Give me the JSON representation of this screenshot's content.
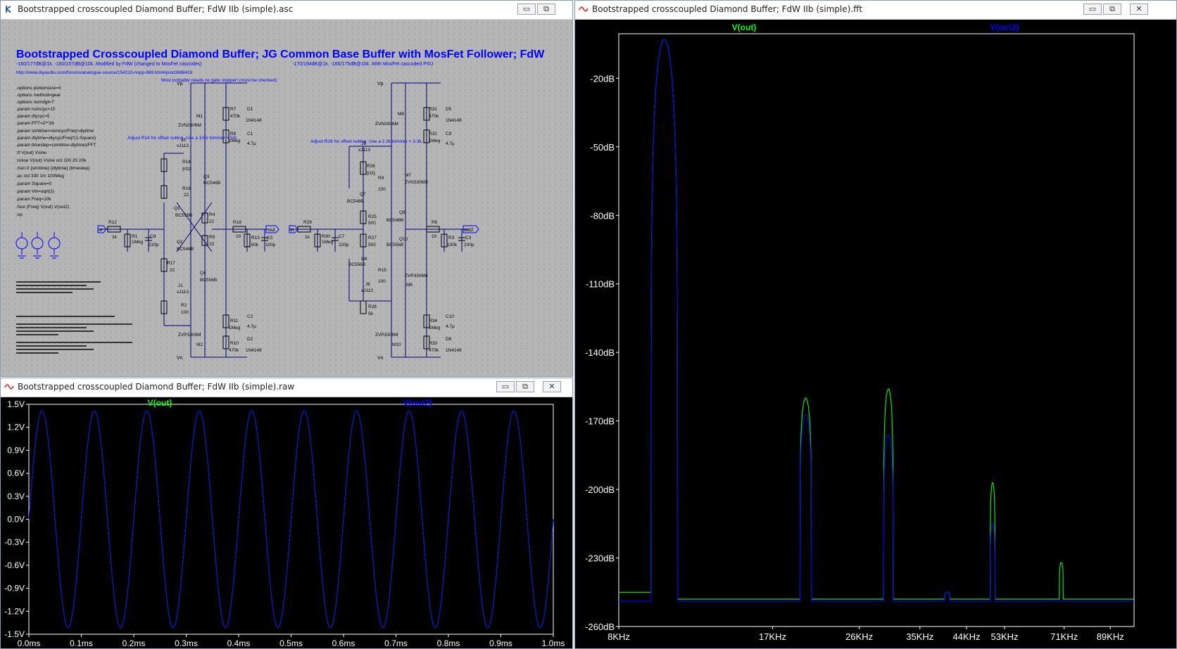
{
  "windows": {
    "schematic": {
      "title": "Bootstrapped crosscoupled Diamond Buffer; FdW IIb (simple).asc",
      "headline": "Bootstrapped Crosscoupled Diamond Buffer; JG Common Base Buffer with MosFet Follower; FdW",
      "sub_left": "-160/177dB@1k, -160/157dB@10k..Modified by FdW (changed to MosFet cascodes)",
      "sub_right": "-170/194dB@1k, -166/175dB@10k..With MosFet cascoded PSU",
      "url": "http://www.diyaudio.com/forums/analogue-source/154210-nopp-989.html#post3988419",
      "directives": [
        ".options plotwinsize=0",
        ".options method=gear",
        ".options numdgt=7",
        ".param numcyc=10",
        ".param dlycyc=5",
        ".param FFT=2**16",
        ".param simtime=numcyc/Freq+dlytime",
        ".param dlytime=dlycyc/Freq*(1-Square)",
        ".param timestep=(simtime-dlytime)/FFT",
        ";tf V(out) Vsine",
        ";noise V(out) Vsine oct 100 20 20k",
        ".tran 0 {simtime} {dlytime} {timestep}",
        ";ac oct 330 1m 100Meg",
        ".param Square=0",
        ".param Vin=sqrt(2)",
        ".param Freq=10k",
        ".four {Freq} V(out) V(out2)",
        ";op"
      ],
      "notes": {
        "gate": "Most probably needs no gate stopper! (must be checked)",
        "adj1": "Adjust R14 for offset nulling. Use a 100r trimmer + 50r.",
        "adj2": "Adjust R26 for offset nulling. Use a 2.2k trimmer + 3.3k."
      },
      "parts": {
        "vp": "Vp",
        "vn": "Vn",
        "in": "in",
        "out": "out",
        "out2": "out2",
        "r12": "R12",
        "r12v": "1k",
        "r1": "R1",
        "r1v": "1Meg",
        "c8": "C8",
        "c8v": "220p",
        "r14": "R14",
        "r14v": "{rt1}",
        "r16": "R16",
        "r16v": "22",
        "r17": "R17",
        "r17v": "22",
        "r2": "R2",
        "r2v": "100",
        "r4": "R4",
        "r4v": "22",
        "r5": "R5",
        "r5v": "22",
        "r18": "R18",
        "r18v": "10",
        "r13": "R13",
        "r13v": "100k",
        "c5": "C5",
        "c5v": "100p",
        "r7": "R7",
        "r7v": "470k",
        "r8": "R8",
        "r8v": "1Meg",
        "c1": "C1",
        "c1v": "4.7µ",
        "d1": "D1",
        "d1v": "1N4148",
        "m1": "M1",
        "m1v": "ZVN3306M",
        "r11": "R11",
        "r11v": "1Meg",
        "r10": "R10",
        "r10v": "470k",
        "c2": "C2",
        "c2v": "4.7µ",
        "d2": "D2",
        "d2v": "1N4148",
        "m2": "M2",
        "m2v": "ZVP3306M",
        "j3": "J3",
        "j3v": "xJ113",
        "j1": "J1",
        "j1v": "xJ113",
        "q1": "Q1",
        "q1v": "BC556B",
        "q2": "Q2",
        "q2v": "BC546B",
        "q3": "Q3",
        "q3v": "BC546B",
        "q4": "Q4",
        "q4v": "BC556B",
        "r29": "R29",
        "r29v": "1k",
        "r30": "R30",
        "r30v": "1Meg",
        "c7": "C7",
        "c7v": "220p",
        "r26": "R26",
        "r26v": "{rt2}",
        "r9": "R9",
        "r9v": "100",
        "r25": "R25",
        "r25v": "500",
        "r27": "R27",
        "r27v": "500",
        "r15": "R15",
        "r15v": "100",
        "r28": "R28",
        "r28v": "5k",
        "r6": "R6",
        "r6v": "10",
        "r3": "R3",
        "r3v": "100k",
        "c3": "C3",
        "c3v": "100p",
        "j5": "J5",
        "j5v": "xJ113",
        "j6": "J6",
        "j6v": "xJ113",
        "q7": "Q7",
        "q7v": "BC546B",
        "q8": "Q8",
        "q8v": "BC556B",
        "q9": "Q9",
        "q9v": "BC546B",
        "q10": "Q10",
        "q10v": "BC556B",
        "m7": "M7",
        "m7v": "ZVN3306M",
        "m8": "M8",
        "m8v": "ZVP3306M",
        "m9": "M9",
        "m9v": "ZVN3306M",
        "m10": "M10",
        "m10v": "ZVP3306M",
        "r31": "R31",
        "r31v": "470k",
        "r32": "R32",
        "r32v": "1Meg",
        "c9": "C9",
        "c9v": "4.7µ",
        "d5": "D5",
        "d5v": "1N4148",
        "r34": "R34",
        "r34v": "1Meg",
        "r33": "R33",
        "r33v": "470k",
        "c10": "C10",
        "c10v": "4.7µ",
        "d6": "D6",
        "d6v": "1N4148"
      }
    },
    "transient": {
      "title": "Bootstrapped crosscoupled Diamond Buffer; FdW IIb (simple).raw"
    },
    "fft": {
      "title": "Bootstrapped crosscoupled Diamond Buffer; FdW IIb (simple).fft"
    }
  },
  "window_buttons": {
    "minimize": "▭",
    "restore": "⧉",
    "close": "✕"
  },
  "colors": {
    "trace_out": "#00ff00",
    "trace_out2": "#0000ff",
    "schematic_text": "#0000ff",
    "schematic_bg": "#b5b5b5",
    "plot_bg": "#000000",
    "axis_text": "#ffffff"
  },
  "chart_data": [
    {
      "type": "line",
      "name": "transient",
      "series": [
        {
          "name": "V(out)",
          "color": "#00ff00",
          "amplitude": 1.414,
          "frequency_hz": 10000
        },
        {
          "name": "V(out2)",
          "color": "#0000ff",
          "amplitude": 1.414,
          "frequency_hz": 10000
        }
      ],
      "x_ticks": [
        "0.0ms",
        "0.1ms",
        "0.2ms",
        "0.3ms",
        "0.4ms",
        "0.5ms",
        "0.6ms",
        "0.7ms",
        "0.8ms",
        "0.9ms",
        "1.0ms"
      ],
      "y_ticks": [
        "1.5V",
        "1.2V",
        "0.9V",
        "0.6V",
        "0.3V",
        "0.0V",
        "-0.3V",
        "-0.6V",
        "-0.9V",
        "-1.2V",
        "-1.5V"
      ],
      "xlim": [
        0,
        1.0
      ],
      "ylim": [
        -1.5,
        1.5
      ],
      "grid": false
    },
    {
      "type": "line",
      "name": "fft",
      "x_scale": "log",
      "xlim": [
        8000,
        100000
      ],
      "ylim": [
        -260,
        -0.5
      ],
      "x_ticks": [
        {
          "label": "8KHz",
          "v": 8000
        },
        {
          "label": "17KHz",
          "v": 17000
        },
        {
          "label": "26KHz",
          "v": 26000
        },
        {
          "label": "35KHz",
          "v": 35000
        },
        {
          "label": "44KHz",
          "v": 44000
        },
        {
          "label": "53KHz",
          "v": 53000
        },
        {
          "label": "71KHz",
          "v": 71000
        },
        {
          "label": "89KHz",
          "v": 89000
        }
      ],
      "y_ticks": [
        {
          "label": "-20dB",
          "v": -20
        },
        {
          "label": "-50dB",
          "v": -50
        },
        {
          "label": "-80dB",
          "v": -80
        },
        {
          "label": "-110dB",
          "v": -110
        },
        {
          "label": "-140dB",
          "v": -140
        },
        {
          "label": "-170dB",
          "v": -170
        },
        {
          "label": "-200dB",
          "v": -200
        },
        {
          "label": "-230dB",
          "v": -230
        },
        {
          "label": "-260dB",
          "v": -260
        }
      ],
      "series": [
        {
          "name": "V(out)",
          "color": "#00ff00",
          "floor": -248,
          "peaks": [
            {
              "f": 10000,
              "db": -3,
              "w": 0.028
            },
            {
              "f": 20000,
              "db": -160,
              "w": 0.012
            },
            {
              "f": 30000,
              "db": -156,
              "w": 0.01
            },
            {
              "f": 40000,
              "db": -245,
              "w": 0.005
            },
            {
              "f": 50000,
              "db": -197,
              "w": 0.005
            },
            {
              "f": 70000,
              "db": -232,
              "w": 0.004
            }
          ]
        },
        {
          "name": "V(out2)",
          "color": "#0000ff",
          "floor": -249,
          "peaks": [
            {
              "f": 10000,
              "db": -3,
              "w": 0.028
            },
            {
              "f": 20000,
              "db": -167,
              "w": 0.012
            },
            {
              "f": 30000,
              "db": -176,
              "w": 0.01
            },
            {
              "f": 40000,
              "db": -245,
              "w": 0.005
            },
            {
              "f": 50000,
              "db": -215,
              "w": 0.005
            }
          ]
        }
      ],
      "grid": false
    }
  ]
}
